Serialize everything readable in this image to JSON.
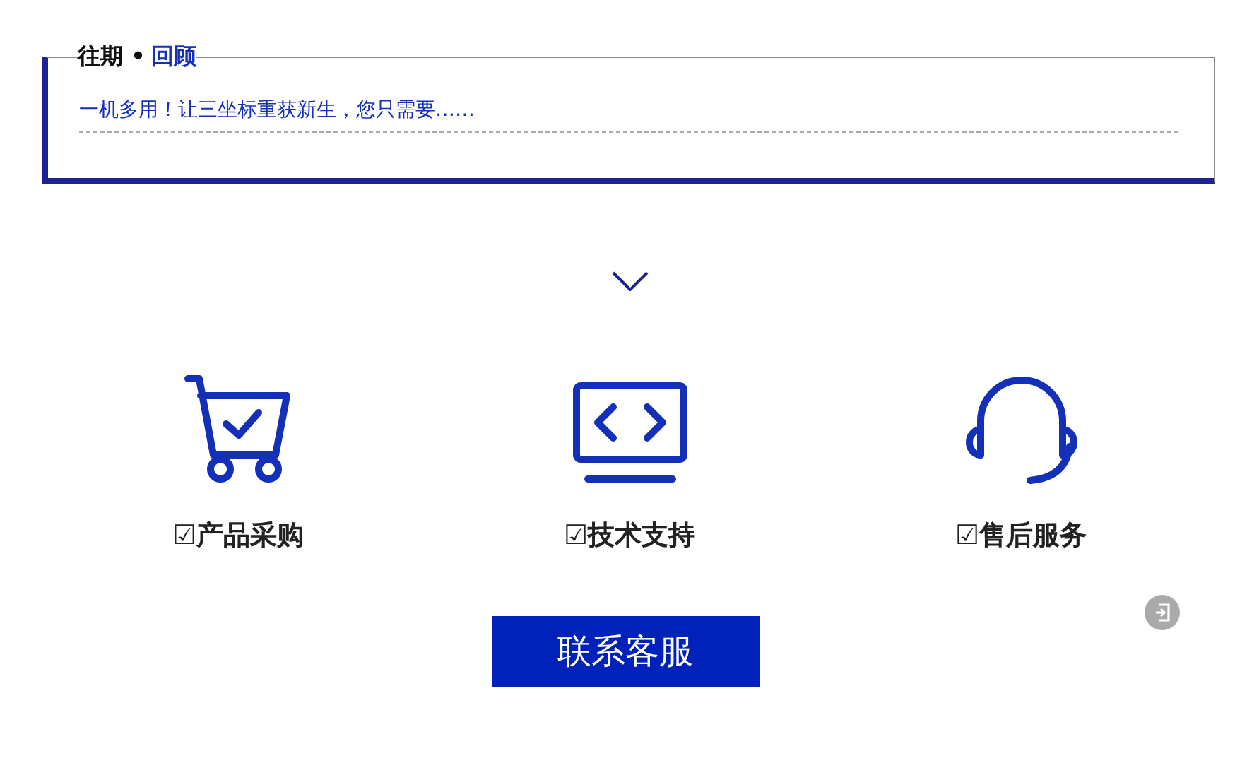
{
  "review": {
    "heading": "往期 •",
    "heading_accent": "回顾",
    "link": "一机多用！让三坐标重获新生，您只需要……"
  },
  "services": [
    {
      "kind": "cart",
      "label": "☑产品采购"
    },
    {
      "kind": "code",
      "label": "☑技术支持"
    },
    {
      "kind": "headset",
      "label": "☑售后服务"
    }
  ],
  "contact_button": "联系客服"
}
